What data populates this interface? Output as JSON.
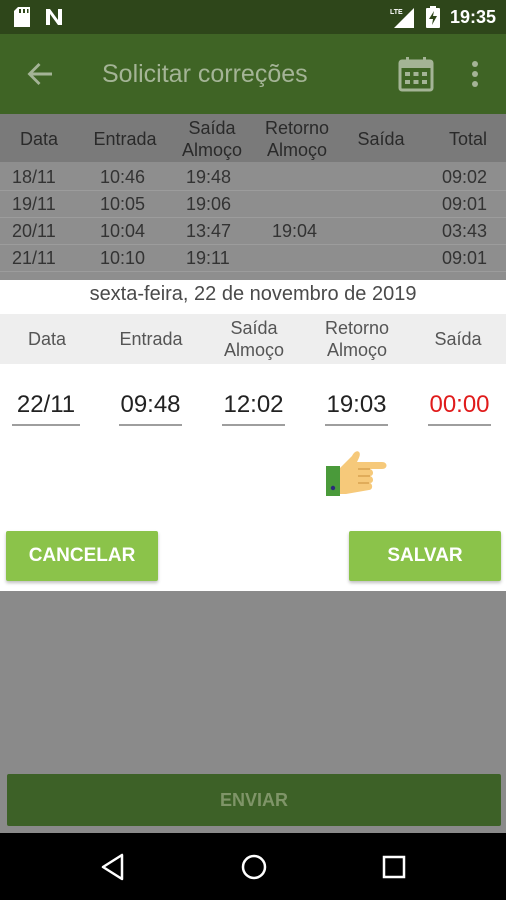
{
  "status_bar": {
    "time": "19:35",
    "network": "LTE",
    "icons": [
      "sd-card-icon",
      "n-notification-icon",
      "lte-signal-icon",
      "battery-charging-icon"
    ]
  },
  "app_bar": {
    "title": "Solicitar correções",
    "icons": [
      "back-arrow-icon",
      "calendar-icon",
      "more-vert-icon"
    ]
  },
  "background_table": {
    "headers": {
      "data": "Data",
      "entrada": "Entrada",
      "saida_almoco_1": "Saída",
      "saida_almoco_2": "Almoço",
      "retorno_almoco_1": "Retorno",
      "retorno_almoco_2": "Almoço",
      "saida": "Saída",
      "total": "Total"
    },
    "rows": [
      {
        "data": "18/11",
        "entrada": "10:46",
        "saida_almoco": "19:48",
        "retorno_almoco": "",
        "saida": "",
        "total": "09:02"
      },
      {
        "data": "19/11",
        "entrada": "10:05",
        "saida_almoco": "19:06",
        "retorno_almoco": "",
        "saida": "",
        "total": "09:01"
      },
      {
        "data": "20/11",
        "entrada": "10:04",
        "saida_almoco": "13:47",
        "retorno_almoco": "19:04",
        "saida": "",
        "total": "03:43"
      },
      {
        "data": "21/11",
        "entrada": "10:10",
        "saida_almoco": "19:11",
        "retorno_almoco": "",
        "saida": "",
        "total": "09:01"
      }
    ]
  },
  "dialog": {
    "date_label": "sexta-feira, 22 de novembro de 2019",
    "headers": {
      "data": "Data",
      "entrada": "Entrada",
      "saida_almoco_1": "Saída",
      "saida_almoco_2": "Almoço",
      "retorno_almoco_1": "Retorno",
      "retorno_almoco_2": "Almoço",
      "saida": "Saída"
    },
    "fields": {
      "data": "22/11",
      "entrada": "09:48",
      "saida_almoco": "12:02",
      "retorno_almoco": "19:03",
      "saida": "00:00"
    },
    "cancel_label": "CANCELAR",
    "save_label": "SALVAR"
  },
  "send_label": "ENVIAR",
  "colors": {
    "status_bar": "#2e461a",
    "app_bar": "#3f6425",
    "button_green": "#8bc34a",
    "error_red": "#e01b1b",
    "send_button": "#3d6127"
  }
}
